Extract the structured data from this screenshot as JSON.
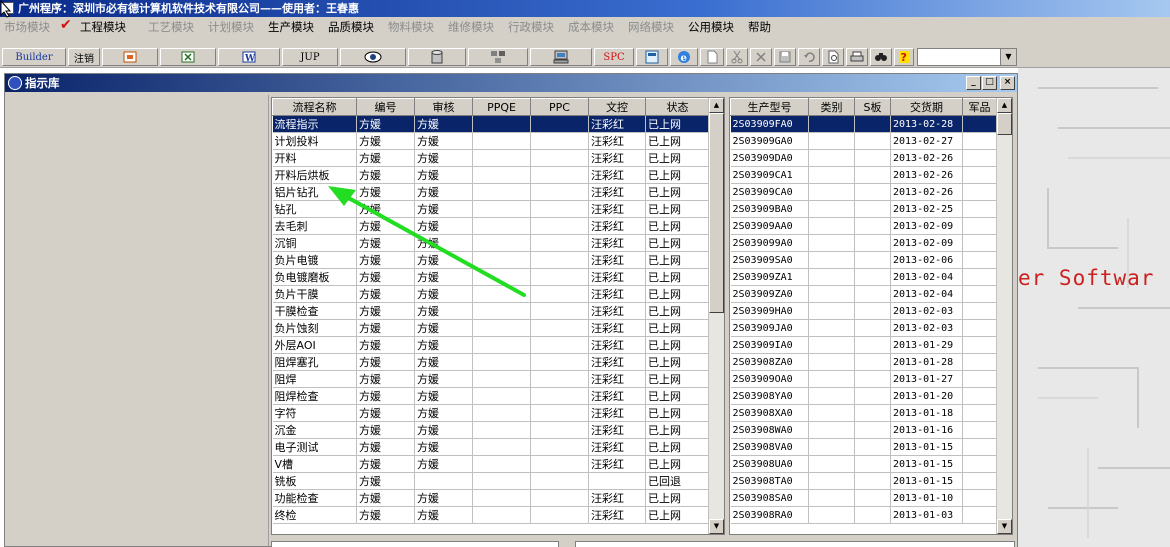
{
  "window_title": "广州程序：深圳市必有德计算机软件技术有限公司——使用者：王春惠",
  "menu": [
    {
      "label": "市场模块",
      "disabled": true
    },
    {
      "label": "工程模块",
      "disabled": false,
      "checked": true
    },
    {
      "label": "工艺模块",
      "disabled": true
    },
    {
      "label": "计划模块",
      "disabled": true
    },
    {
      "label": "生产模块",
      "disabled": false
    },
    {
      "label": "品质模块",
      "disabled": false
    },
    {
      "label": "物料模块",
      "disabled": true
    },
    {
      "label": "维修模块",
      "disabled": true
    },
    {
      "label": "行政模块",
      "disabled": true
    },
    {
      "label": "成本模块",
      "disabled": true
    },
    {
      "label": "网络模块",
      "disabled": true
    },
    {
      "label": "公用模块",
      "disabled": false
    },
    {
      "label": "帮助",
      "disabled": false
    }
  ],
  "toolbar": {
    "builder_label": "Builder",
    "logout_label": "注销",
    "jup_label": "JUP",
    "spc_label": "SPC",
    "icons": [
      "ppt-icon",
      "excel-icon",
      "word-icon",
      "eye-icon",
      "database-icon",
      "network-icon",
      "computer-icon",
      "calculator-icon",
      "ie-icon",
      "new-doc-icon",
      "cut-icon",
      "delete-icon",
      "save-icon",
      "undo-icon",
      "preview-icon",
      "print-icon",
      "find-icon",
      "help-icon"
    ]
  },
  "child_window": {
    "title": "指示库",
    "buttons": [
      "_",
      "□",
      "×"
    ]
  },
  "process_grid": {
    "columns": [
      "流程名称",
      "编号",
      "审核",
      "PPQE",
      "PPC",
      "文控",
      "状态"
    ],
    "rows": [
      [
        "流程指示",
        "方媛",
        "方媛",
        "",
        "",
        "汪彩红",
        "已上网"
      ],
      [
        "计划投料",
        "方媛",
        "方媛",
        "",
        "",
        "汪彩红",
        "已上网"
      ],
      [
        "开料",
        "方媛",
        "方媛",
        "",
        "",
        "汪彩红",
        "已上网"
      ],
      [
        "开料后烘板",
        "方媛",
        "方媛",
        "",
        "",
        "汪彩红",
        "已上网"
      ],
      [
        "铝片钻孔",
        "方媛",
        "方媛",
        "",
        "",
        "汪彩红",
        "已上网"
      ],
      [
        "钻孔",
        "方媛",
        "方媛",
        "",
        "",
        "汪彩红",
        "已上网"
      ],
      [
        "去毛刺",
        "方媛",
        "方媛",
        "",
        "",
        "汪彩红",
        "已上网"
      ],
      [
        "沉铜",
        "方媛",
        "方媛",
        "",
        "",
        "汪彩红",
        "已上网"
      ],
      [
        "负片电镀",
        "方媛",
        "方媛",
        "",
        "",
        "汪彩红",
        "已上网"
      ],
      [
        "负电镀磨板",
        "方媛",
        "方媛",
        "",
        "",
        "汪彩红",
        "已上网"
      ],
      [
        "负片干膜",
        "方媛",
        "方媛",
        "",
        "",
        "汪彩红",
        "已上网"
      ],
      [
        "干膜检查",
        "方媛",
        "方媛",
        "",
        "",
        "汪彩红",
        "已上网"
      ],
      [
        "负片蚀刻",
        "方媛",
        "方媛",
        "",
        "",
        "汪彩红",
        "已上网"
      ],
      [
        "外层AOI",
        "方媛",
        "方媛",
        "",
        "",
        "汪彩红",
        "已上网"
      ],
      [
        "阻焊塞孔",
        "方媛",
        "方媛",
        "",
        "",
        "汪彩红",
        "已上网"
      ],
      [
        "阻焊",
        "方媛",
        "方媛",
        "",
        "",
        "汪彩红",
        "已上网"
      ],
      [
        "阻焊检查",
        "方媛",
        "方媛",
        "",
        "",
        "汪彩红",
        "已上网"
      ],
      [
        "字符",
        "方媛",
        "方媛",
        "",
        "",
        "汪彩红",
        "已上网"
      ],
      [
        "沉金",
        "方媛",
        "方媛",
        "",
        "",
        "汪彩红",
        "已上网"
      ],
      [
        "电子测试",
        "方媛",
        "方媛",
        "",
        "",
        "汪彩红",
        "已上网"
      ],
      [
        "V槽",
        "方媛",
        "方媛",
        "",
        "",
        "汪彩红",
        "已上网"
      ],
      [
        "铣板",
        "方媛",
        "",
        "",
        "",
        "",
        "已回退"
      ],
      [
        "功能检查",
        "方媛",
        "方媛",
        "",
        "",
        "汪彩红",
        "已上网"
      ],
      [
        "终检",
        "方媛",
        "方媛",
        "",
        "",
        "汪彩红",
        "已上网"
      ]
    ]
  },
  "product_grid": {
    "columns": [
      "生产型号",
      "类别",
      "S板",
      "交货期",
      "军品"
    ],
    "rows": [
      [
        "2S03909FA0",
        "",
        "",
        "2013-02-28",
        ""
      ],
      [
        "2S03909GA0",
        "",
        "",
        "2013-02-27",
        ""
      ],
      [
        "2S03909DA0",
        "",
        "",
        "2013-02-26",
        ""
      ],
      [
        "2S03909CA1",
        "",
        "",
        "2013-02-26",
        ""
      ],
      [
        "2S03909CA0",
        "",
        "",
        "2013-02-26",
        ""
      ],
      [
        "2S03909BA0",
        "",
        "",
        "2013-02-25",
        ""
      ],
      [
        "2S03909AA0",
        "",
        "",
        "2013-02-09",
        ""
      ],
      [
        "2S039099A0",
        "",
        "",
        "2013-02-09",
        ""
      ],
      [
        "2S03909SA0",
        "",
        "",
        "2013-02-06",
        ""
      ],
      [
        "2S03909ZA1",
        "",
        "",
        "2013-02-04",
        ""
      ],
      [
        "2S03909ZA0",
        "",
        "",
        "2013-02-04",
        ""
      ],
      [
        "2S03909HA0",
        "",
        "",
        "2013-02-03",
        ""
      ],
      [
        "2S03909JA0",
        "",
        "",
        "2013-02-03",
        ""
      ],
      [
        "2S03909IA0",
        "",
        "",
        "2013-01-29",
        ""
      ],
      [
        "2S03908ZA0",
        "",
        "",
        "2013-01-28",
        ""
      ],
      [
        "2S03909OA0",
        "",
        "",
        "2013-01-27",
        ""
      ],
      [
        "2S03908YA0",
        "",
        "",
        "2013-01-20",
        ""
      ],
      [
        "2S03908XA0",
        "",
        "",
        "2013-01-18",
        ""
      ],
      [
        "2S03908WA0",
        "",
        "",
        "2013-01-16",
        ""
      ],
      [
        "2S03908VA0",
        "",
        "",
        "2013-01-15",
        ""
      ],
      [
        "2S03908UA0",
        "",
        "",
        "2013-01-15",
        ""
      ],
      [
        "2S03908TA0",
        "",
        "",
        "2013-01-15",
        ""
      ],
      [
        "2S03908SA0",
        "",
        "",
        "2013-01-10",
        ""
      ],
      [
        "2S03908RA0",
        "",
        "",
        "2013-01-03",
        ""
      ]
    ]
  },
  "background_text": "er Softwar",
  "colors": {
    "selection": "#0a246a",
    "annotation_arrow": "#22dd22",
    "background_text": "#cc2020"
  }
}
